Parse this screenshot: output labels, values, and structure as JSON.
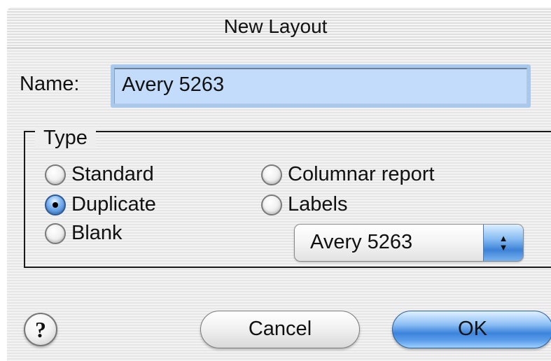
{
  "window": {
    "title": "New Layout"
  },
  "name_field": {
    "label": "Name:",
    "value": "Avery 5263"
  },
  "type_group": {
    "legend": "Type",
    "options": [
      {
        "label": "Standard",
        "checked": false
      },
      {
        "label": "Duplicate",
        "checked": true
      },
      {
        "label": "Blank",
        "checked": false
      },
      {
        "label": "Columnar report",
        "checked": false
      },
      {
        "label": "Labels",
        "checked": false
      }
    ],
    "label_type_popup": {
      "selected": "Avery 5263"
    }
  },
  "buttons": {
    "help": "?",
    "cancel": "Cancel",
    "ok": "OK"
  },
  "colors": {
    "default_button": "#3b84dc",
    "text_field_selection": "#c3dcfb"
  },
  "icons": {
    "help": "help-icon",
    "popup_arrows": "up-down-arrows-icon"
  }
}
